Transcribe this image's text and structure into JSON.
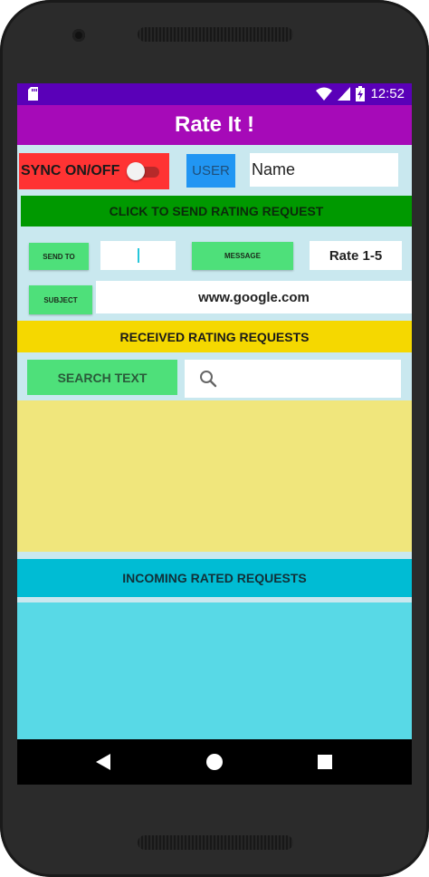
{
  "status_bar": {
    "time": "12:52"
  },
  "app": {
    "title": "Rate It !"
  },
  "top_row": {
    "sync_label": "SYNC ON/OFF",
    "user_label": "USER",
    "name_value": "Name"
  },
  "send_rating_label": "CLICK TO SEND RATING REQUEST",
  "row_send": {
    "send_to_label": "SEND TO",
    "send_to_value": "",
    "message_label": "MESSAGE",
    "message_value": "Rate 1-5"
  },
  "row_subject": {
    "subject_label": "SUBJECT",
    "subject_value": "www.google.com"
  },
  "received_label": "RECEIVED RATING REQUESTS",
  "search": {
    "button_label": "SEARCH TEXT",
    "query": ""
  },
  "incoming_label": "INCOMING RATED REQUESTS",
  "colors": {
    "status_bar": "#5a00b8",
    "app_bar": "#a60ab8",
    "sync_red": "#ff3333",
    "user_blue": "#2196f3",
    "send_green": "#009900",
    "button_green": "#4ee07a",
    "received_yellow": "#f5d800",
    "list_yellow": "#f0e67c",
    "incoming_cyan": "#00bcd4",
    "list_cyan": "#58d9e6"
  },
  "icons": [
    "sd-card-icon",
    "wifi-icon",
    "signal-icon",
    "battery-charging-icon",
    "search-icon",
    "back-icon",
    "home-icon",
    "recents-icon"
  ]
}
